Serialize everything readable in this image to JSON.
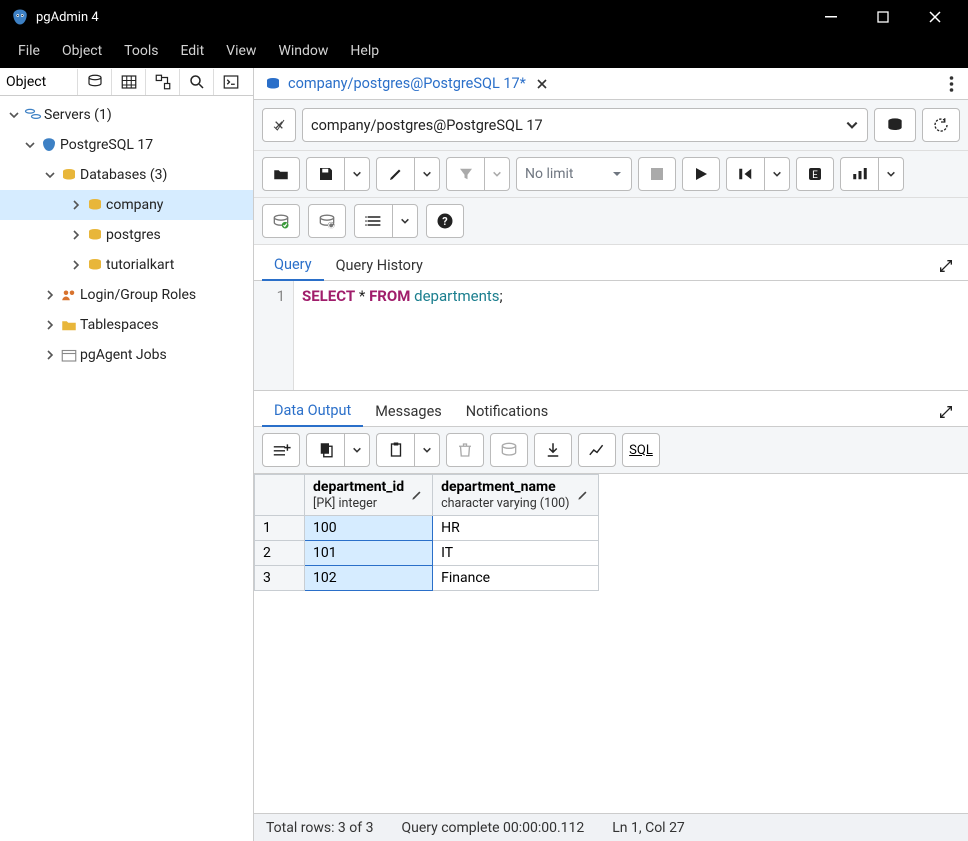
{
  "titlebar": {
    "title": "pgAdmin 4"
  },
  "menubar": [
    "File",
    "Object",
    "Tools",
    "Edit",
    "View",
    "Window",
    "Help"
  ],
  "sidebar": {
    "header_label": "Object",
    "tree": {
      "servers": "Servers (1)",
      "pg17": "PostgreSQL 17",
      "databases": "Databases (3)",
      "db_company": "company",
      "db_postgres": "postgres",
      "db_tutorialkart": "tutorialkart",
      "login_roles": "Login/Group Roles",
      "tablespaces": "Tablespaces",
      "pgagent": "pgAgent Jobs"
    }
  },
  "main": {
    "tab_label": "company/postgres@PostgreSQL 17*",
    "connection_label": "company/postgres@PostgreSQL 17",
    "limit_label": "No limit",
    "editor_tabs": {
      "query": "Query",
      "history": "Query History"
    },
    "gutter_line": "1",
    "sql": {
      "kw_select": "SELECT",
      "star": "*",
      "kw_from": "FROM",
      "ident": "departments",
      "semi": ";"
    },
    "output_tabs": {
      "data": "Data Output",
      "messages": "Messages",
      "notifications": "Notifications"
    },
    "sql_badge": "SQL",
    "columns": [
      {
        "name": "department_id",
        "type": "[PK] integer"
      },
      {
        "name": "department_name",
        "type": "character varying (100)"
      }
    ],
    "rows": [
      {
        "n": "1",
        "id": "100",
        "name": "HR"
      },
      {
        "n": "2",
        "id": "101",
        "name": "IT"
      },
      {
        "n": "3",
        "id": "102",
        "name": "Finance"
      }
    ],
    "status": {
      "total": "Total rows: 3 of 3",
      "complete": "Query complete 00:00:00.112",
      "pos": "Ln 1, Col 27"
    }
  }
}
